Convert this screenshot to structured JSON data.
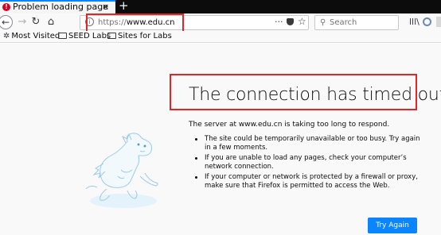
{
  "browser": {
    "tab": {
      "title": "Problem loading page",
      "alert_glyph": "!",
      "close_glyph": "×"
    },
    "new_tab_glyph": "+",
    "nav": {
      "back_glyph": "←",
      "forward_glyph": "→",
      "reload_glyph": "↻",
      "home_glyph": "⌂"
    },
    "url": {
      "scheme": "https://",
      "host": "www.edu.cn"
    },
    "url_actions": {
      "more_glyph": "···",
      "star_glyph": "☆"
    },
    "search": {
      "placeholder": "Search",
      "icon_glyph": "⚲"
    },
    "library_glyph": "lll\\",
    "bookmarks": [
      {
        "label": "Most Visited",
        "icon": "gear-icon",
        "glyph": "✲"
      },
      {
        "label": "SEED Labs",
        "icon": "folder-icon"
      },
      {
        "label": "Sites for Labs",
        "icon": "folder-icon"
      }
    ]
  },
  "error_page": {
    "title": "The connection has timed out",
    "description": "The server at www.edu.cn is taking too long to respond.",
    "reasons": [
      "The site could be temporarily unavailable or too busy. Try again in a few moments.",
      "If you are unable to load any pages, check your computer’s network connection.",
      "If your computer or network is protected by a firewall or proxy, make sure that Firefox is permitted to access the Web."
    ],
    "try_again_label": "Try Again"
  },
  "colors": {
    "accent": "#0a84ff",
    "annotation_red": "#e52525",
    "tab_alert": "#d70022"
  }
}
